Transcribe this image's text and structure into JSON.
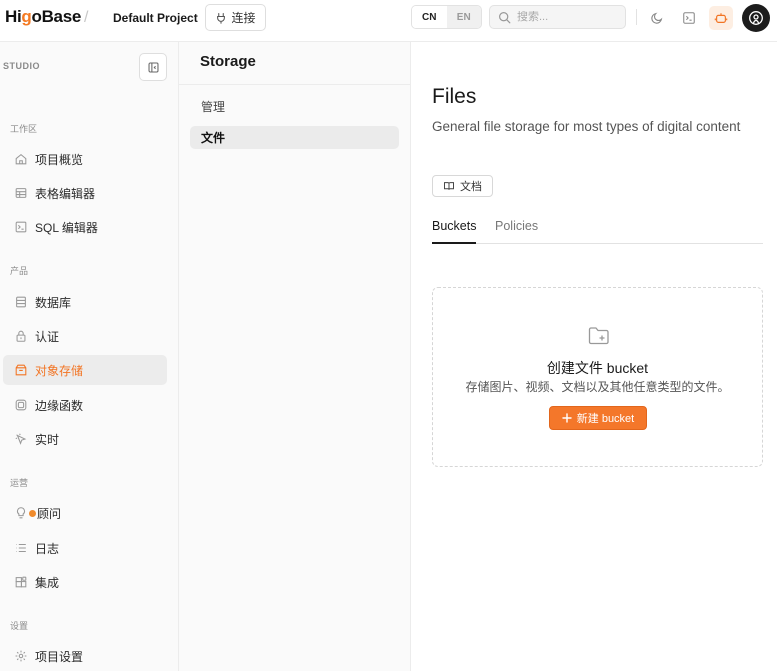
{
  "colors": {
    "accent": "#f4772a",
    "active_text": "#f27423",
    "sidebar_bg": "#fafafa",
    "border": "#ececec"
  },
  "header": {
    "logo_prefix": "Hi",
    "logo_dot": "g",
    "logo_suffix": "oBase",
    "separator": "/",
    "project": "Default Project",
    "connect_label": "连接",
    "lang_cn": "CN",
    "lang_en": "EN",
    "search_placeholder": "搜索...",
    "icons": [
      "moon-icon",
      "terminal-icon",
      "assistant-bot-icon",
      "user-avatar-icon"
    ]
  },
  "sidebar": {
    "studio_label": "STUDIO",
    "sections": [
      {
        "label": "工作区",
        "items": [
          {
            "label": "项目概览",
            "icon": "home-icon"
          },
          {
            "label": "表格编辑器",
            "icon": "table-icon"
          },
          {
            "label": "SQL 编辑器",
            "icon": "terminal-icon"
          }
        ]
      },
      {
        "label": "产品",
        "items": [
          {
            "label": "数据库",
            "icon": "database-icon"
          },
          {
            "label": "认证",
            "icon": "lock-icon"
          },
          {
            "label": "对象存储",
            "icon": "storage-icon",
            "active": true
          },
          {
            "label": "边缘函数",
            "icon": "functions-icon"
          },
          {
            "label": "实时",
            "icon": "realtime-icon"
          }
        ]
      },
      {
        "label": "运营",
        "items": [
          {
            "label": "顾问",
            "icon": "lightbulb-icon"
          },
          {
            "label": "日志",
            "icon": "list-icon"
          },
          {
            "label": "集成",
            "icon": "integrations-icon"
          }
        ]
      },
      {
        "label": "设置",
        "items": [
          {
            "label": "项目设置",
            "icon": "gear-icon"
          }
        ]
      }
    ]
  },
  "panel": {
    "title": "Storage",
    "items": [
      {
        "label": "管理",
        "active": false
      },
      {
        "label": "文件",
        "active": true
      }
    ]
  },
  "main": {
    "title": "Files",
    "description": "General file storage for most types of digital content",
    "doc_button": "文档",
    "tabs": [
      {
        "label": "Buckets",
        "active": true
      },
      {
        "label": "Policies",
        "active": false
      }
    ],
    "empty_title": "创建文件 bucket",
    "empty_subtitle": "存储图片、视频、文档以及其他任意类型的文件。",
    "new_button": "新建 bucket"
  }
}
